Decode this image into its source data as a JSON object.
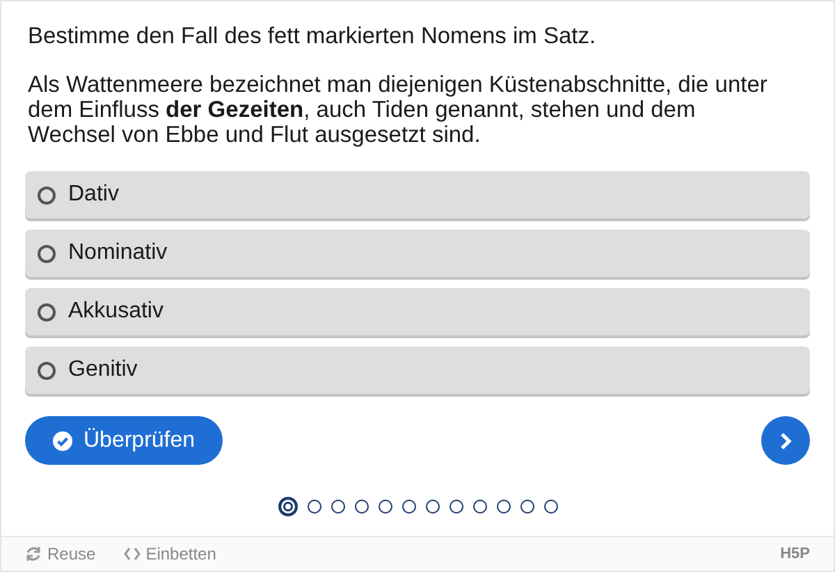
{
  "task": "Bestimme den Fall des fett markierten Nomens im Satz.",
  "sentence": "Als Wattenmeere bezeichnet man diejenigen Küstenabschnitte, die unter dem Einfluss **der Gezeiten**, auch Tiden genannt, stehen und dem Wechsel von Ebbe und Flut ausgesetzt sind.",
  "options": [
    {
      "label": "Dativ",
      "selected": false
    },
    {
      "label": "Nominativ",
      "selected": false
    },
    {
      "label": "Akkusativ",
      "selected": false
    },
    {
      "label": "Genitiv",
      "selected": false
    }
  ],
  "check_button": "Überprüfen",
  "pages": [
    {
      "selected": true
    },
    {
      "selected": false
    },
    {
      "selected": false
    },
    {
      "selected": false
    },
    {
      "selected": false
    },
    {
      "selected": false
    },
    {
      "selected": false
    },
    {
      "selected": false
    },
    {
      "selected": false
    },
    {
      "selected": false
    },
    {
      "selected": false
    },
    {
      "selected": false
    }
  ],
  "footer": {
    "reuse": "Reuse",
    "embed": "Einbetten",
    "logo": "H5P"
  }
}
